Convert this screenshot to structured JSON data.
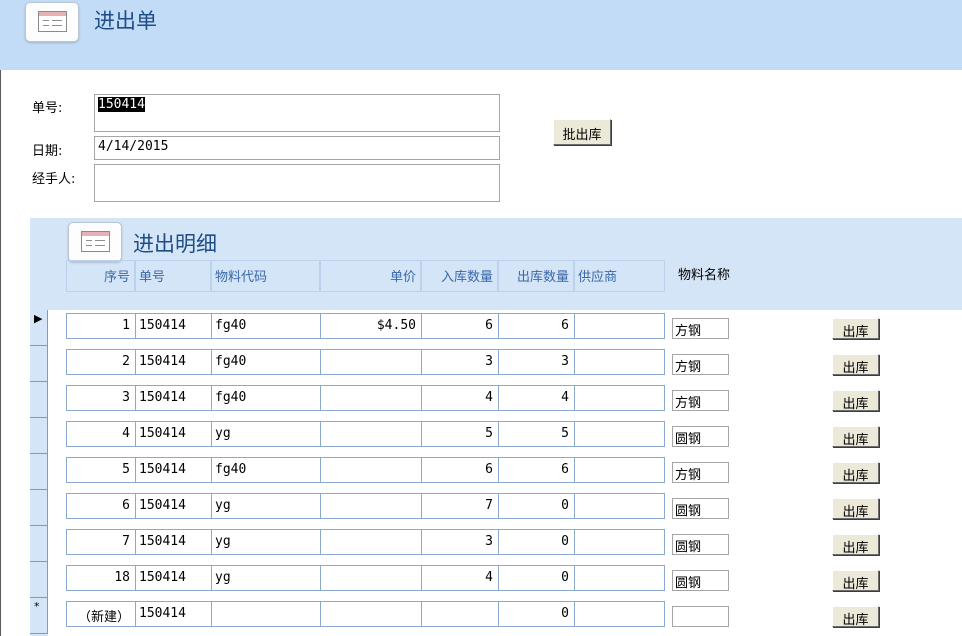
{
  "header": {
    "title": "进出单"
  },
  "form": {
    "order_no_label": "单号:",
    "order_no_value": "150414",
    "date_label": "日期:",
    "date_value": "4/14/2015",
    "handler_label": "经手人:",
    "handler_value": "",
    "batch_button": "批出库"
  },
  "detail": {
    "title": "进出明细",
    "columns": {
      "seq": "序号",
      "order_no": "单号",
      "material_code": "物料代码",
      "unit_price": "单价",
      "in_qty": "入库数量",
      "out_qty": "出库数量",
      "supplier": "供应商",
      "material_name": "物料名称"
    },
    "row_button_label": "出库",
    "current_row_indicator": "▶",
    "new_row_indicator": "*",
    "rows": [
      {
        "seq": "1",
        "order_no": "150414",
        "material_code": "fg40",
        "unit_price": "$4.50",
        "in_qty": "6",
        "out_qty": "6",
        "supplier": "",
        "material_name": "方钢"
      },
      {
        "seq": "2",
        "order_no": "150414",
        "material_code": "fg40",
        "unit_price": "",
        "in_qty": "3",
        "out_qty": "3",
        "supplier": "",
        "material_name": "方钢"
      },
      {
        "seq": "3",
        "order_no": "150414",
        "material_code": "fg40",
        "unit_price": "",
        "in_qty": "4",
        "out_qty": "4",
        "supplier": "",
        "material_name": "方钢"
      },
      {
        "seq": "4",
        "order_no": "150414",
        "material_code": "yg",
        "unit_price": "",
        "in_qty": "5",
        "out_qty": "5",
        "supplier": "",
        "material_name": "圆钢"
      },
      {
        "seq": "5",
        "order_no": "150414",
        "material_code": "fg40",
        "unit_price": "",
        "in_qty": "6",
        "out_qty": "6",
        "supplier": "",
        "material_name": "方钢"
      },
      {
        "seq": "6",
        "order_no": "150414",
        "material_code": "yg",
        "unit_price": "",
        "in_qty": "7",
        "out_qty": "0",
        "supplier": "",
        "material_name": "圆钢"
      },
      {
        "seq": "7",
        "order_no": "150414",
        "material_code": "yg",
        "unit_price": "",
        "in_qty": "3",
        "out_qty": "0",
        "supplier": "",
        "material_name": "圆钢"
      },
      {
        "seq": "18",
        "order_no": "150414",
        "material_code": "yg",
        "unit_price": "",
        "in_qty": "4",
        "out_qty": "0",
        "supplier": "",
        "material_name": "圆钢"
      },
      {
        "seq": "（新建）",
        "order_no": "150414",
        "material_code": "",
        "unit_price": "",
        "in_qty": "",
        "out_qty": "0",
        "supplier": "",
        "material_name": ""
      }
    ]
  }
}
